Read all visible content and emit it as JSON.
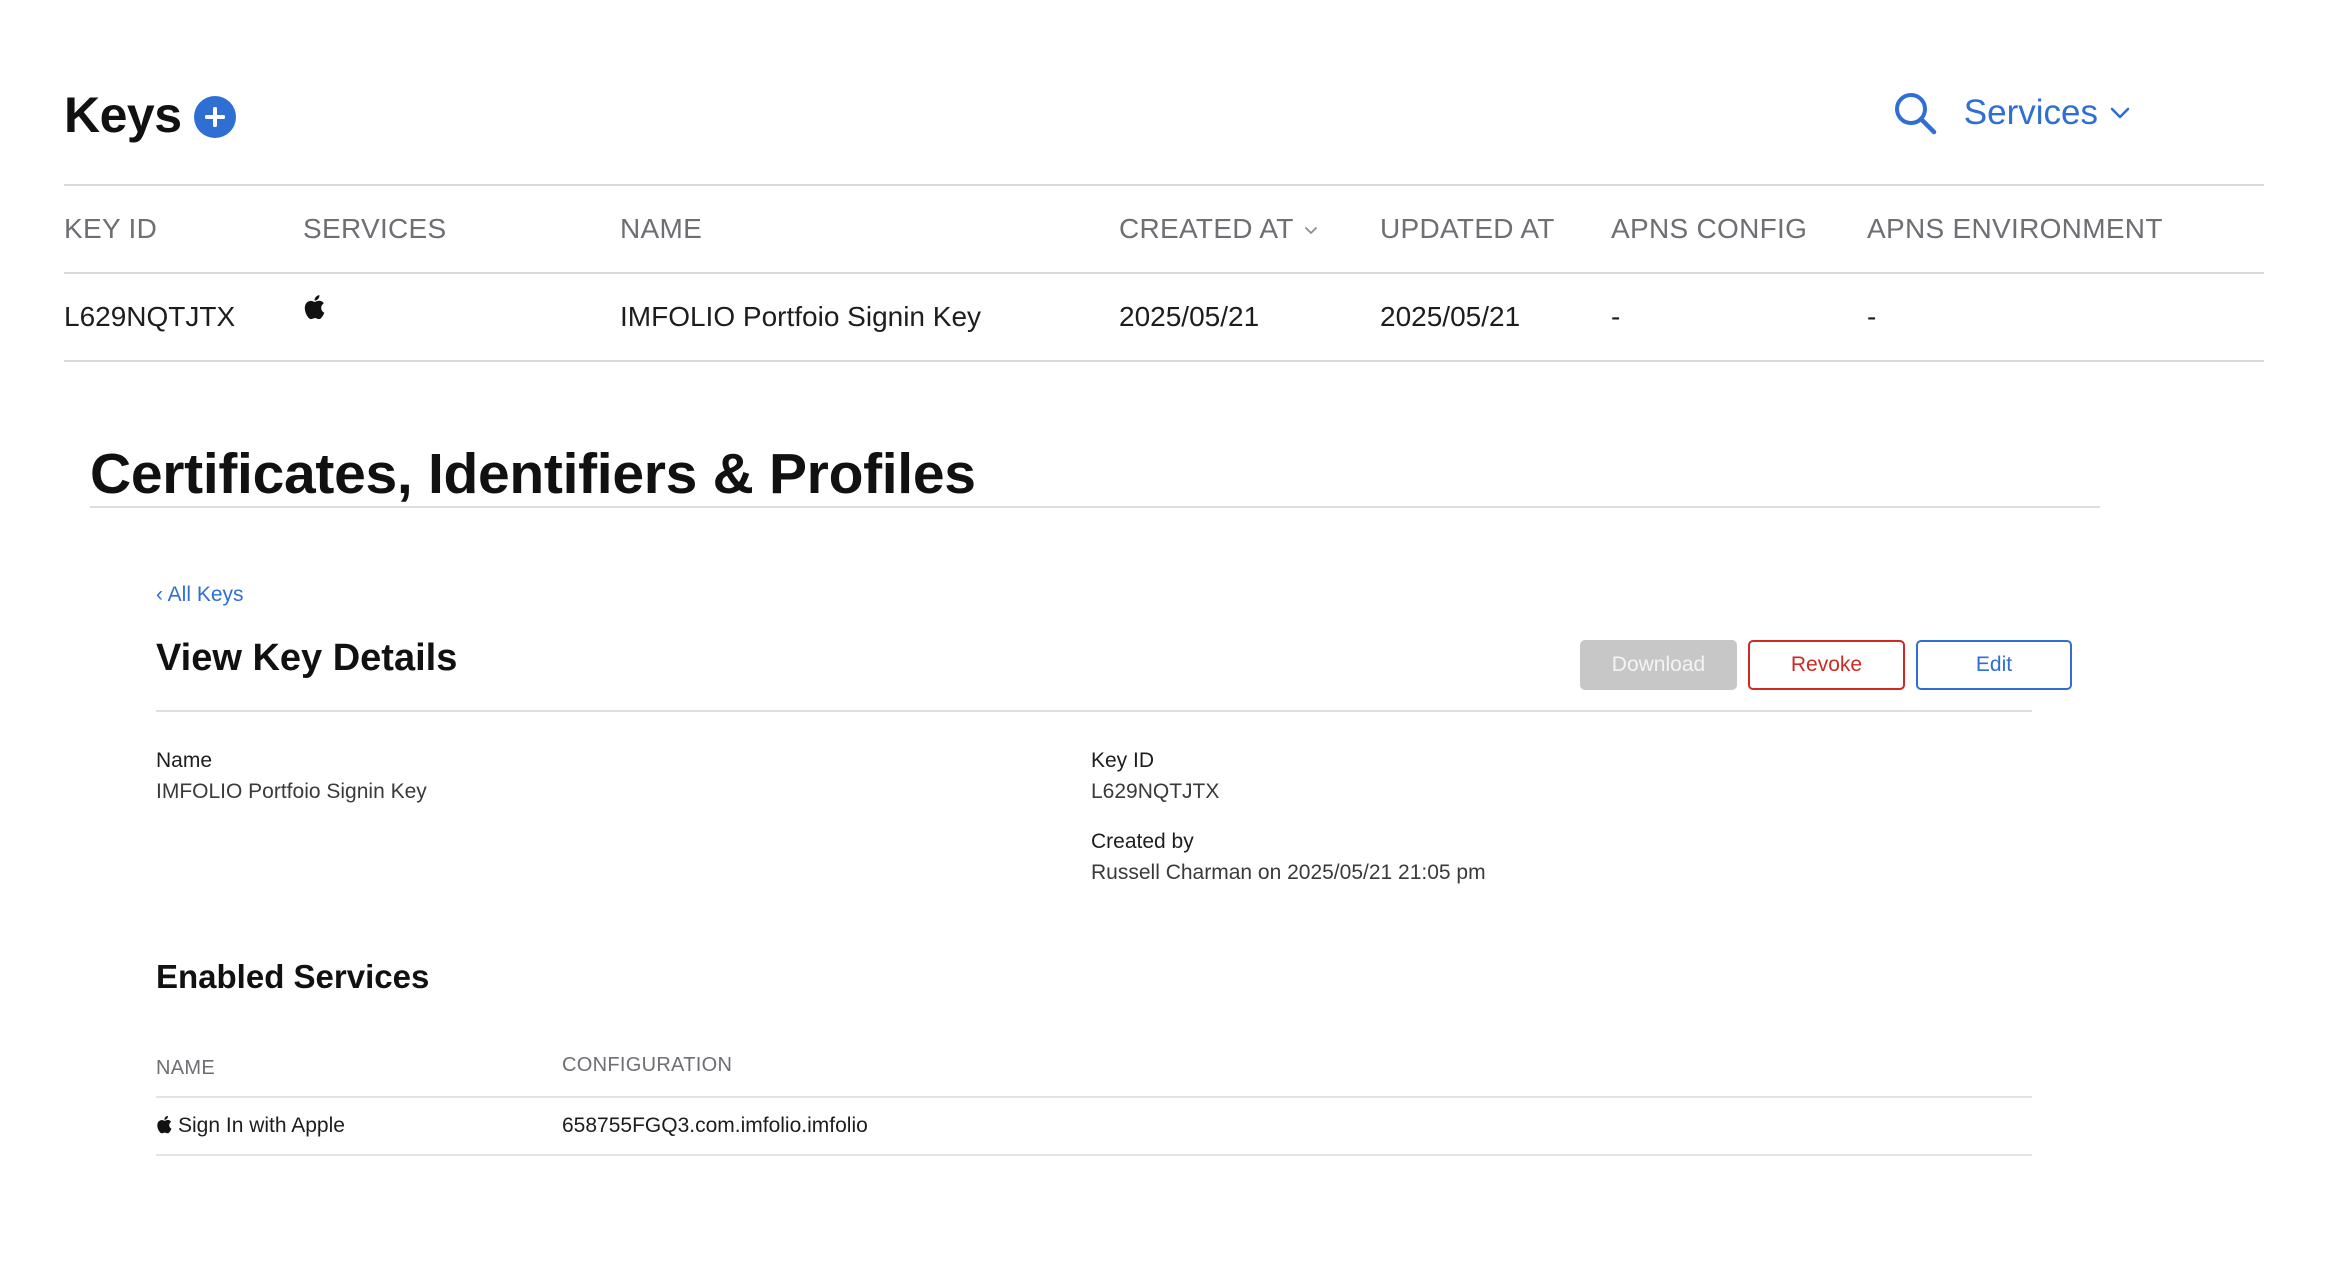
{
  "keys_list": {
    "title": "Keys",
    "add_icon": "plus-circle-icon",
    "search_icon": "search-icon",
    "services_filter_label": "Services",
    "columns": {
      "key_id": "KEY ID",
      "services": "SERVICES",
      "name": "NAME",
      "created_at": "CREATED AT",
      "updated_at": "UPDATED AT",
      "apns_config": "APNS CONFIG",
      "apns_environment": "APNS ENVIRONMENT"
    },
    "rows": [
      {
        "key_id": "L629NQTJTX",
        "services_icon": "apple-icon",
        "name": "IMFOLIO Portfoio Signin Key",
        "created_at": "2025/05/21",
        "updated_at": "2025/05/21",
        "apns_config": "-",
        "apns_environment": "-"
      }
    ]
  },
  "page_title": "Certificates, Identifiers & Profiles",
  "details": {
    "back_link": "‹ All Keys",
    "title": "View Key Details",
    "buttons": {
      "download": "Download",
      "revoke": "Revoke",
      "edit": "Edit"
    },
    "name_label": "Name",
    "name_value": "IMFOLIO Portfoio Signin Key",
    "key_id_label": "Key ID",
    "key_id_value": "L629NQTJTX",
    "created_by_label": "Created by",
    "created_by_value": "Russell Charman on 2025/05/21 21:05 pm"
  },
  "enabled_services": {
    "title": "Enabled Services",
    "columns": {
      "name": "NAME",
      "configuration": "CONFIGURATION"
    },
    "rows": [
      {
        "icon": "apple-icon",
        "name": "Sign In with Apple",
        "configuration": "658755FGQ3.com.imfolio.imfolio"
      }
    ]
  },
  "colors": {
    "accent": "#2f6fd4",
    "danger": "#cc2a22",
    "disabled": "#c7c7c7"
  }
}
